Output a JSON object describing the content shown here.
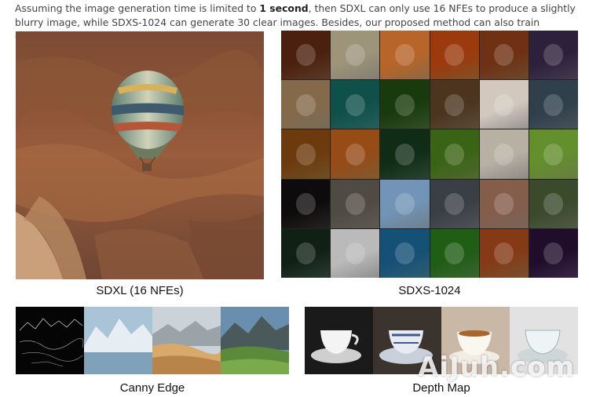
{
  "caption": {
    "part1": "Assuming the image generation time is limited to ",
    "bold": "1 second",
    "part2": ", then SDXL can only use 16 NFEs to produce a slightly blurry image, while SDXS-1024 can generate 30 clear images. Besides, our proposed method can also train ControlNet."
  },
  "panels": {
    "sdxl_label": "SDXL (16 NFEs)",
    "sdxs_label": "SDXS-1024",
    "canny_label": "Canny Edge",
    "depth_label": "Depth Map"
  },
  "watermark": "AiJuh.com",
  "grid_tiles": [
    {
      "name": "woman-portrait",
      "bg": "#8a5a3c"
    },
    {
      "name": "white-horse",
      "bg": "#c9c2b0"
    },
    {
      "name": "horse-rider-desert",
      "bg": "#d9a066"
    },
    {
      "name": "orange-car",
      "bg": "#c77a3a"
    },
    {
      "name": "apple-on-table",
      "bg": "#a86f45"
    },
    {
      "name": "mountain-lake-sunset",
      "bg": "#6b5a7a"
    },
    {
      "name": "medusa-sculpture",
      "bg": "#b8a48a"
    },
    {
      "name": "dog-with-ball",
      "bg": "#3f8f8a"
    },
    {
      "name": "forest-rider",
      "bg": "#4f7a3a"
    },
    {
      "name": "jeep-canyon",
      "bg": "#8b7358"
    },
    {
      "name": "strawberry-bowl",
      "bg": "#e8e2dc"
    },
    {
      "name": "castle-cliff",
      "bg": "#6d7f8a"
    },
    {
      "name": "golden-warrior-woman",
      "bg": "#a77a3a"
    },
    {
      "name": "lion-savanna",
      "bg": "#c48a4a"
    },
    {
      "name": "forest-fairy",
      "bg": "#3f6a4a"
    },
    {
      "name": "green-hills-road",
      "bg": "#7aa04a"
    },
    {
      "name": "teacup",
      "bg": "#d8d4cc"
    },
    {
      "name": "green-field",
      "bg": "#9fbf6a"
    },
    {
      "name": "old-man-hat",
      "bg": "#3a3634"
    },
    {
      "name": "cat-by-window",
      "bg": "#8f8a82"
    },
    {
      "name": "penguins-snow",
      "bg": "#aac2d8"
    },
    {
      "name": "vintage-car-street",
      "bg": "#7a7f86"
    },
    {
      "name": "pink-roses",
      "bg": "#b89a8a"
    },
    {
      "name": "lake-town",
      "bg": "#7a8a6a"
    },
    {
      "name": "astronaut-jungle",
      "bg": "#3f5a4a"
    },
    {
      "name": "robot-parts",
      "bg": "#dadada"
    },
    {
      "name": "floating-island",
      "bg": "#4a8fae"
    },
    {
      "name": "park-trees",
      "bg": "#5a9a4a"
    },
    {
      "name": "fantasy-city",
      "bg": "#b87a4a"
    },
    {
      "name": "neon-city",
      "bg": "#5a3a6a"
    }
  ]
}
